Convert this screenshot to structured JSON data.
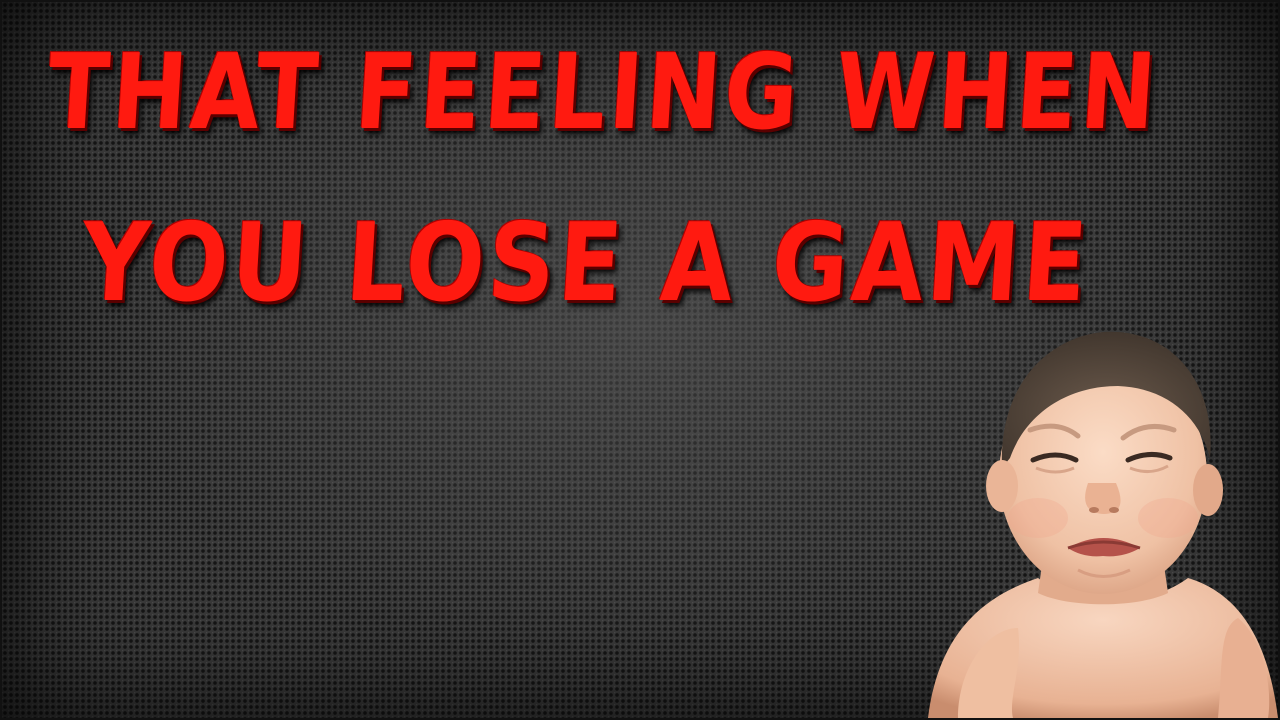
{
  "meme": {
    "line1": "THAT FEELING WHEN",
    "line2": "YOU LOSE A GAME"
  },
  "colors": {
    "title_red": "#ff1a10",
    "background": "#3a3a3a",
    "skin": "#f3c9ae"
  },
  "image": {
    "subject": "crying-baby"
  }
}
